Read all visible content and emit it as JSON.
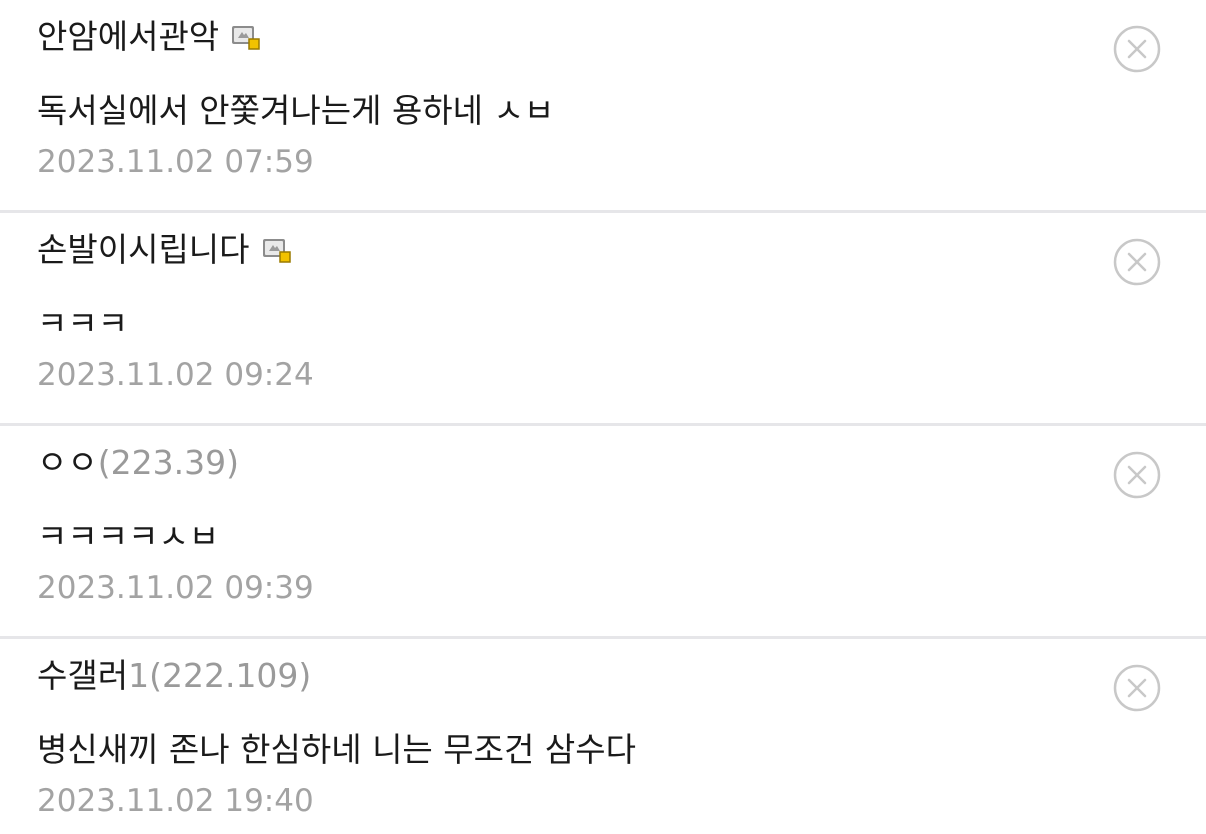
{
  "comments": [
    {
      "author": "안암에서관악",
      "author_ip": "",
      "gallery_badge": "gallery-member-icon",
      "text": "독서실에서 안쫓겨나는게 용하네 ㅅㅂ",
      "timestamp": "2023.11.02 07:59"
    },
    {
      "author": "손발이시립니다",
      "author_ip": "",
      "gallery_badge": "gallery-member-icon",
      "text": "ㅋㅋㅋ",
      "timestamp": "2023.11.02 09:24"
    },
    {
      "author": "ㅇㅇ",
      "author_ip": "(223.39)",
      "text": "ㅋㅋㅋㅋㅅㅂ",
      "timestamp": "2023.11.02 09:39"
    },
    {
      "author": "수갤러",
      "author_ip": "1(222.109)",
      "text": "병신새끼 존나 한심하네 니는 무조건 삼수다",
      "timestamp": "2023.11.02 19:40"
    }
  ],
  "colors": {
    "text": "#1a1a1a",
    "meta": "#a3a3a3",
    "divider": "#e6e6e9",
    "delete_icon": "#c8c8c8"
  }
}
